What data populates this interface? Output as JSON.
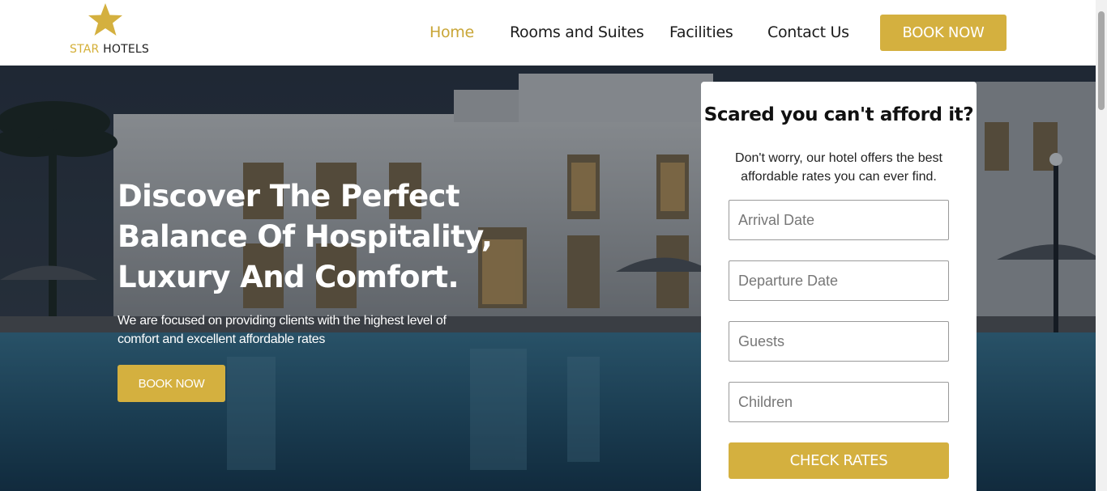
{
  "brand": {
    "star_word": "STAR",
    "hotels_word": "HOTELS",
    "logo_icon": "star-icon",
    "accent_color": "#d4b03f"
  },
  "nav": {
    "items": [
      {
        "label": "Home",
        "active": true
      },
      {
        "label": "Rooms and Suites",
        "active": false
      },
      {
        "label": "Facilities",
        "active": false
      },
      {
        "label": "Contact Us",
        "active": false
      }
    ],
    "book_label": "BOOK NOW"
  },
  "hero": {
    "title": "Discover The Perfect Balance Of Hospitality, Luxury And Comfort.",
    "subtitle": "We are focused on providing clients with the highest level of comfort and excellent affordable rates",
    "book_label": "BOOK NOW"
  },
  "booking": {
    "title": "Scared you can't afford it?",
    "text": "Don't worry, our hotel offers the best affordable rates you can ever find.",
    "arrival_placeholder": "Arrival Date",
    "departure_placeholder": "Departure Date",
    "guests_placeholder": "Guests",
    "children_placeholder": "Children",
    "submit_label": "CHECK RATES"
  }
}
